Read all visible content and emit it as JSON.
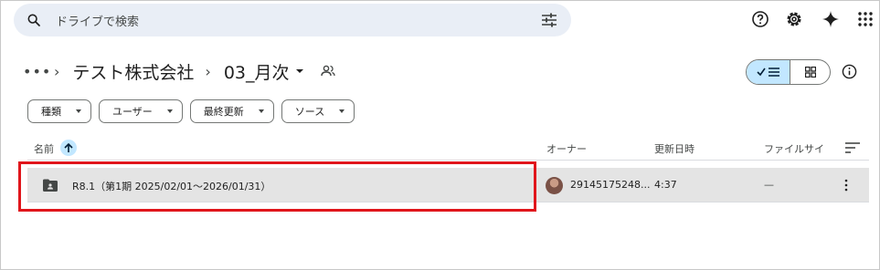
{
  "search": {
    "placeholder": "ドライブで検索"
  },
  "top_icons": [
    "help-icon",
    "settings-icon",
    "gemini-sparkle-icon",
    "apps-grid-icon"
  ],
  "breadcrumb": {
    "more": "•••",
    "separator": "›",
    "parent": "テスト株式会社",
    "current": "03_月次"
  },
  "filters": [
    {
      "label": "種類"
    },
    {
      "label": "ユーザー"
    },
    {
      "label": "最終更新"
    },
    {
      "label": "ソース"
    }
  ],
  "columns": {
    "name": "名前",
    "owner": "オーナー",
    "modified": "更新日時",
    "size": "ファイルサイ"
  },
  "rows": [
    {
      "name": "R8.1（第1期 2025/02/01～2026/01/31）",
      "owner": "29145175248...",
      "modified": "4:37",
      "size": "—"
    }
  ],
  "colors": {
    "accent_light": "#c2e7ff",
    "search_bg": "#e9eef6",
    "highlight": "#e0161c",
    "row_selected": "#e4e4e4"
  }
}
